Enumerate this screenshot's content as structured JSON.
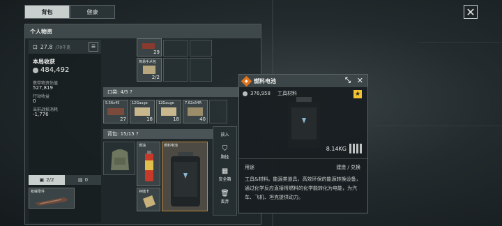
{
  "tabs": [
    {
      "label": "背包"
    },
    {
      "label": "健康"
    }
  ],
  "personal": {
    "title": "个人物资",
    "weight": "27.8",
    "weight_unit": "/70千克",
    "income_title": "本局收获",
    "income_value": "484,492",
    "carry_label": "携带物资估值",
    "carry_value": "527,819",
    "action_label": "行动收益",
    "action_value": "0",
    "loss_label": "当前战损消耗",
    "loss_value": "-1,776",
    "case_count": "2/2",
    "case2_count": "0",
    "weapon_label": "枪械零件"
  },
  "items_top": [
    {
      "label": "",
      "count": "29"
    },
    {
      "label": "简易手术包",
      "count": "2/2"
    }
  ],
  "pocket": {
    "header": "口袋: 4/5",
    "help": "?",
    "items": [
      {
        "label": "5.56x45",
        "count": "27"
      },
      {
        "label": "12Gauge",
        "count": "18"
      },
      {
        "label": "12Gauge",
        "count": "18"
      },
      {
        "label": "7.62x54R",
        "count": "40"
      }
    ]
  },
  "backpack": {
    "header": "背包: 15/15",
    "help": "?",
    "items": [
      {
        "label": "燃油"
      },
      {
        "label": "燃料电池"
      },
      {
        "label": "存储卡"
      }
    ]
  },
  "context_menu": {
    "items": [
      {
        "label": "放入",
        "icon": "put-icon"
      },
      {
        "label": "胸挂",
        "icon": "vest-icon"
      },
      {
        "label": "安全箱",
        "icon": "safe-box-icon"
      },
      {
        "label": "丢弃",
        "icon": "trash-icon"
      }
    ]
  },
  "detail": {
    "title": "燃料电池",
    "price": "376,958",
    "category": "工具材料",
    "weight": "8.14KG",
    "usage_label": "用途",
    "usage_value": "建造 / 兑换",
    "description": "工具&材料。能源类道具，高效环保的能源转换设备，通过化学反应直接将燃料的化学能转化为电能，为汽车、飞机、坦克提供动力。"
  },
  "colors": {
    "accent": "#e0751d",
    "star": "#f2c230"
  }
}
